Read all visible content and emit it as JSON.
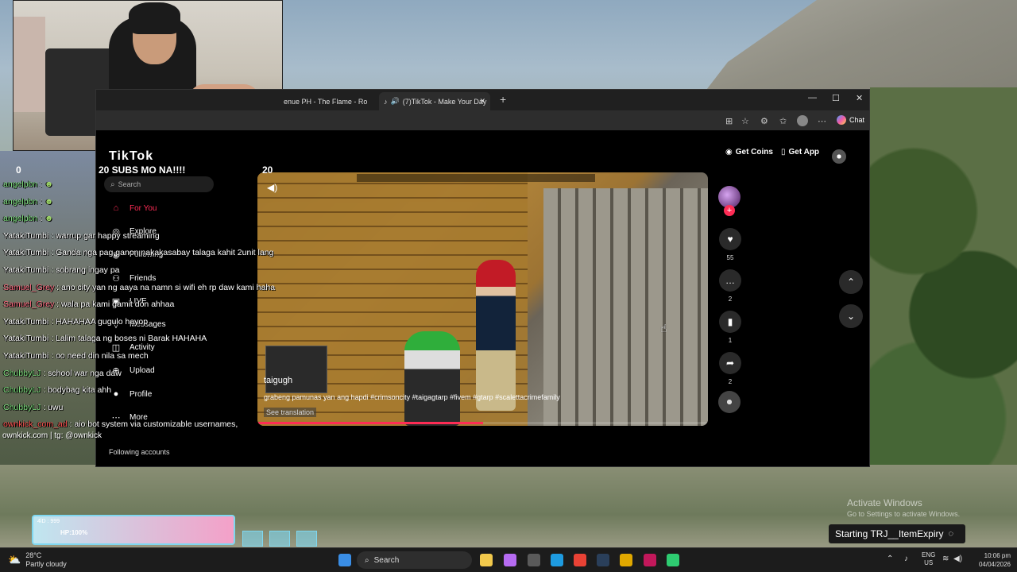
{
  "browser": {
    "tabs": [
      {
        "title": "enue PH - The Flame - Ro"
      },
      {
        "title": "(7)TikTok - Make Your Day"
      }
    ],
    "new_tab": "+",
    "chat_label": "Chat"
  },
  "tiktok": {
    "logo": "TikTok",
    "search_placeholder": "Search",
    "nav": [
      {
        "label": "For You"
      },
      {
        "label": "Explore"
      },
      {
        "label": "Following"
      },
      {
        "label": "Friends"
      },
      {
        "label": "LIVE"
      },
      {
        "label": "Messages"
      },
      {
        "label": "Activity"
      },
      {
        "label": "Upload"
      },
      {
        "label": "Profile"
      },
      {
        "label": "More"
      }
    ],
    "following_accounts": "Following accounts",
    "get_coins": "Get Coins",
    "get_app": "Get App",
    "video": {
      "author": "taigugh",
      "caption": "grabeng pamunas yan ang hapdi #crimsoncity #taigagtarp #fivem #gtarp #scalettacrimefamily",
      "see_translation": "See translation",
      "progress_fraction": 0.5
    },
    "actions": {
      "likes": "55",
      "comments": "2",
      "saves": "1",
      "shares": "2"
    }
  },
  "overlay": {
    "sub_goal": {
      "left": "0",
      "title": "20 SUBS MO NA!!!!",
      "right": "20"
    },
    "chat": [
      {
        "user": "angelpbn",
        "text": "",
        "color": "#7ee07e"
      },
      {
        "user": "angelpbn",
        "text": "",
        "color": "#7ee07e"
      },
      {
        "user": "angelpbn",
        "text": "",
        "color": "#7ee07e"
      },
      {
        "user": "YatakiTumbi",
        "text": "warrup gar happy streaming",
        "color": "#ffffff"
      },
      {
        "user": "YatakiTumbi",
        "text": "Ganda nga pag ganon nakakasabay talaga kahit 2unit lang",
        "color": "#ffffff"
      },
      {
        "user": "YatakiTumbi",
        "text": "sobrang ingay pa",
        "color": "#ffffff"
      },
      {
        "user": "Samuel_Grey",
        "text": "ano city yan ng aaya na namn si wifi eh rp daw kami haha",
        "color": "#ff6b81"
      },
      {
        "user": "Samuel_Grey",
        "text": "wala pa kami gamit don ahhaa",
        "color": "#ff6b81"
      },
      {
        "user": "YatakiTumbi",
        "text": "HAHAHAA gugulo hayop",
        "color": "#ffffff"
      },
      {
        "user": "YatakiTumbi",
        "text": "Lalim talaga ng boses ni Barak HAHAHA",
        "color": "#ffffff"
      },
      {
        "user": "YatakiTumbi",
        "text": "oo need din nila sa mech",
        "color": "#ffffff"
      },
      {
        "user": "ChubbyLJ",
        "text": "school war nga daw",
        "color": "#7ee07e"
      },
      {
        "user": "ChubbyLJ",
        "text": "bodybag kita ahh",
        "color": "#7ee07e"
      },
      {
        "user": "ChubbyLJ",
        "text": "uwu",
        "color": "#7ee07e"
      },
      {
        "user": "ownkick_com_ad",
        "text": "aio bot system via customizable usernames,",
        "color": "#ff4d4d"
      }
    ],
    "promo": "ownkick.com | tg: @ownkick",
    "hud_hp": "HP:100%",
    "hud_zone": "4lD : 999"
  },
  "windows": {
    "activate_title": "Activate Windows",
    "activate_sub": "Go to Settings to activate Windows.",
    "toast": "Starting TRJ__ItemExpiry",
    "weather_temp": "28°C",
    "weather_desc": "Partly cloudy",
    "search": "Search",
    "lang_1": "ENG",
    "lang_2": "US",
    "time": "10:06 pm",
    "date": "04/04/2026"
  }
}
